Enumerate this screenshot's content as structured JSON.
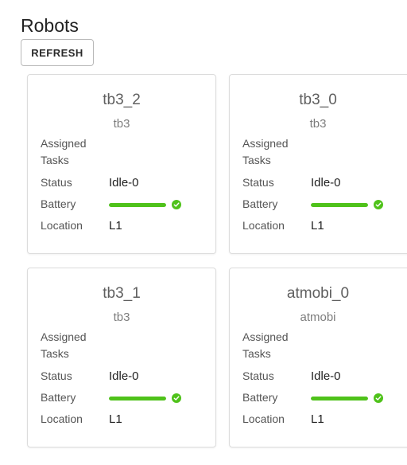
{
  "page": {
    "title": "Robots",
    "refresh_label": "REFRESH"
  },
  "labels": {
    "assigned_tasks": "Assigned Tasks",
    "status": "Status",
    "battery": "Battery",
    "location": "Location"
  },
  "colors": {
    "battery_ok": "#4fc21a"
  },
  "robots": [
    {
      "name": "tb3_2",
      "fleet": "tb3",
      "assigned_tasks": "",
      "status": "Idle-0",
      "battery_fraction": 1.0,
      "battery_icon": "check-circle-icon",
      "location": "L1"
    },
    {
      "name": "tb3_0",
      "fleet": "tb3",
      "assigned_tasks": "",
      "status": "Idle-0",
      "battery_fraction": 1.0,
      "battery_icon": "check-circle-icon",
      "location": "L1"
    },
    {
      "name": "tb3_1",
      "fleet": "tb3",
      "assigned_tasks": "",
      "status": "Idle-0",
      "battery_fraction": 1.0,
      "battery_icon": "check-circle-icon",
      "location": "L1"
    },
    {
      "name": "atmobi_0",
      "fleet": "atmobi",
      "assigned_tasks": "",
      "status": "Idle-0",
      "battery_fraction": 1.0,
      "battery_icon": "check-circle-icon",
      "location": "L1"
    }
  ]
}
